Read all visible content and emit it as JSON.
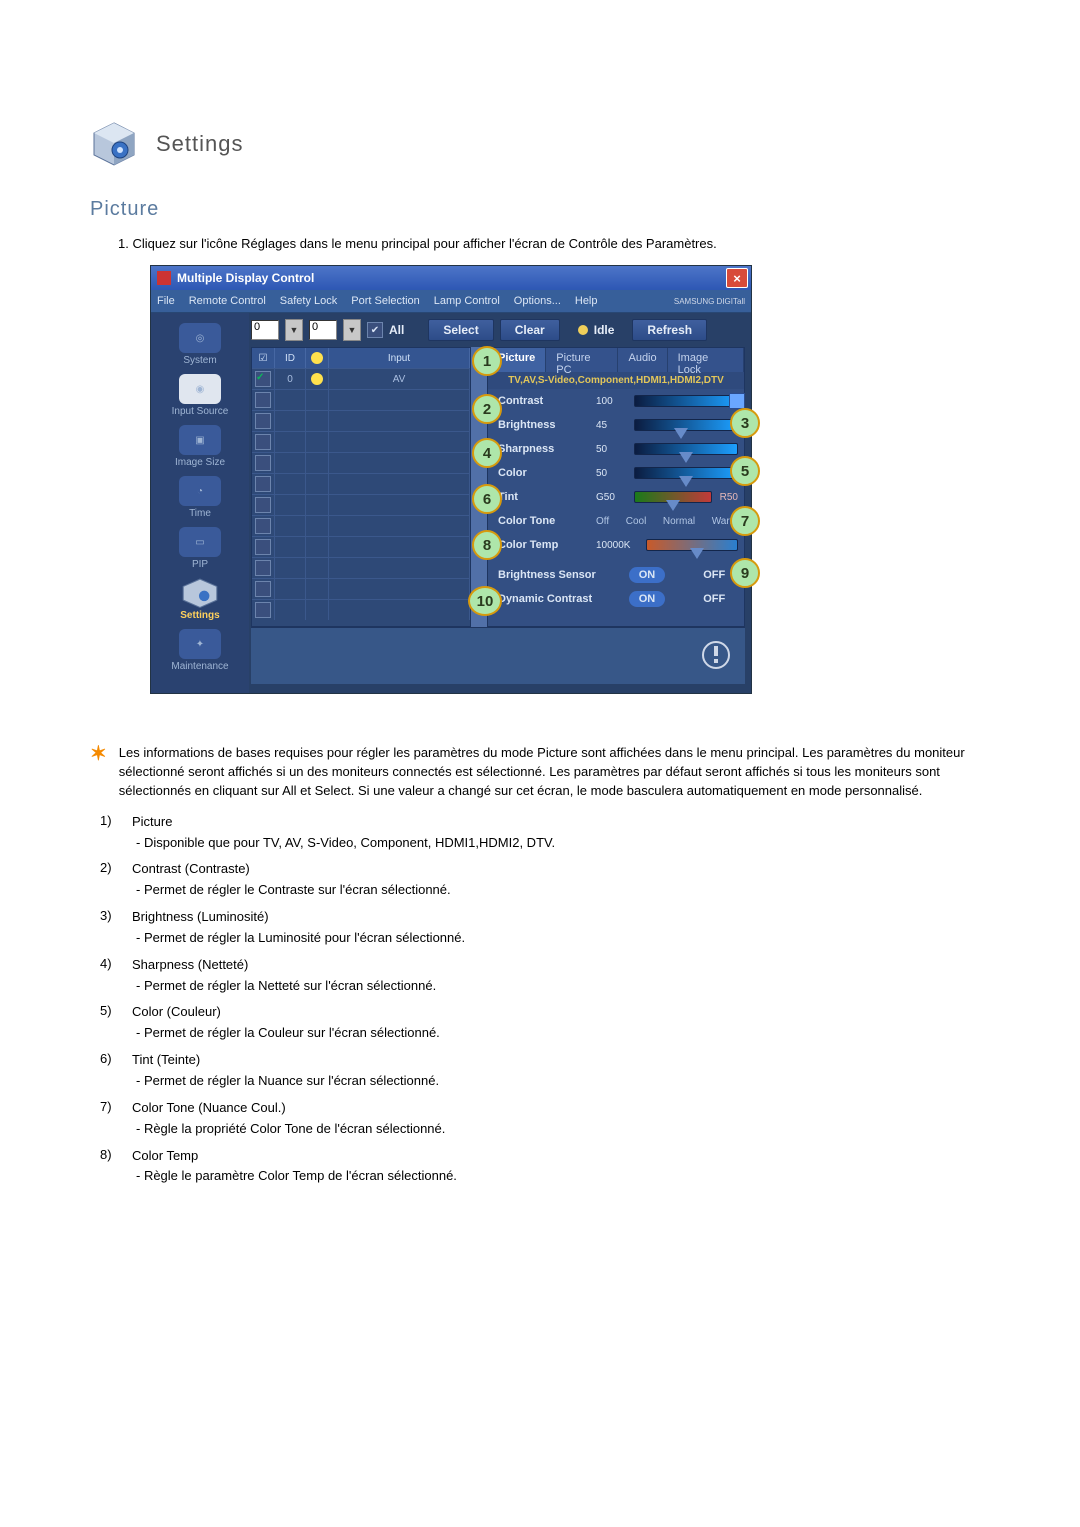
{
  "header": {
    "title": "Settings"
  },
  "section": {
    "title": "Picture"
  },
  "intro": {
    "num": "1.",
    "text": "Cliquez sur l'icône Réglages dans le menu principal pour afficher l'écran de Contrôle des Paramètres."
  },
  "window": {
    "title": "Multiple Display Control",
    "brand": "SAMSUNG DIGITall",
    "menu": [
      "File",
      "Remote Control",
      "Safety Lock",
      "Port Selection",
      "Lamp Control",
      "Options...",
      "Help"
    ],
    "toolbar": {
      "num1": "0",
      "num2": "0",
      "all_label": "All",
      "select_label": "Select",
      "clear_label": "Clear",
      "idle_label": "Idle",
      "refresh_label": "Refresh"
    },
    "sidebar": [
      {
        "label": "System"
      },
      {
        "label": "Input Source"
      },
      {
        "label": "Image Size"
      },
      {
        "label": "Time"
      },
      {
        "label": "PIP"
      },
      {
        "label": "Settings",
        "active": true
      },
      {
        "label": "Maintenance"
      }
    ],
    "grid": {
      "headers": {
        "id": "ID",
        "input": "Input"
      },
      "row1": {
        "id": "0",
        "input": "AV"
      }
    },
    "tabs": [
      "Picture",
      "Picture PC",
      "Audio",
      "Image Lock"
    ],
    "noteline": "TV,AV,S-Video,Component,HDMI1,HDMI2,DTV",
    "params": {
      "contrast": {
        "label": "Contrast",
        "value": "100"
      },
      "brightness": {
        "label": "Brightness",
        "value": "45"
      },
      "sharpness": {
        "label": "Sharpness",
        "value": "50"
      },
      "color": {
        "label": "Color",
        "value": "50"
      },
      "tint": {
        "label": "Tint",
        "value": "G50",
        "right": "R50"
      },
      "colortone": {
        "label": "Color Tone",
        "opts": [
          "Off",
          "Cool",
          "Normal",
          "Warm"
        ]
      },
      "colortemp": {
        "label": "Color Temp",
        "value": "10000K"
      },
      "brightsensor": {
        "label": "Brightness Sensor",
        "on": "ON",
        "off": "OFF"
      },
      "dyncontrast": {
        "label": "Dynamic Contrast",
        "on": "ON",
        "off": "OFF"
      }
    }
  },
  "markers": [
    "1",
    "2",
    "3",
    "4",
    "5",
    "6",
    "7",
    "8",
    "9",
    "10"
  ],
  "note_text": "Les informations de bases requises pour régler les paramètres du mode Picture sont affichées dans le menu principal. Les paramètres du moniteur sélectionné seront affichés si un des moniteurs connectés est sélectionné. Les paramètres par défaut seront affichés si tous les moniteurs sont sélectionnés en cliquant sur All et Select. Si une valeur a changé sur cet écran, le mode basculera automatiquement en mode personnalisé.",
  "items": [
    {
      "n": "1)",
      "t": "Picture",
      "s": "- Disponible que pour TV, AV, S-Video, Component, HDMI1,HDMI2, DTV."
    },
    {
      "n": "2)",
      "t": "Contrast (Contraste)",
      "s": "- Permet de régler le Contraste sur l'écran sélectionné."
    },
    {
      "n": "3)",
      "t": "Brightness (Luminosité)",
      "s": "- Permet de régler la Luminosité pour l'écran sélectionné."
    },
    {
      "n": "4)",
      "t": "Sharpness (Netteté)",
      "s": "- Permet de régler la Netteté sur l'écran sélectionné."
    },
    {
      "n": "5)",
      "t": "Color (Couleur)",
      "s": "- Permet de régler la Couleur sur l'écran sélectionné."
    },
    {
      "n": "6)",
      "t": "Tint (Teinte)",
      "s": "- Permet de régler la Nuance sur l'écran sélectionné."
    },
    {
      "n": "7)",
      "t": "Color Tone (Nuance Coul.)",
      "s": "- Règle la propriété Color Tone de l'écran sélectionné."
    },
    {
      "n": "8)",
      "t": "Color Temp",
      "s": "- Règle le paramètre Color Temp de l'écran sélectionné."
    }
  ]
}
